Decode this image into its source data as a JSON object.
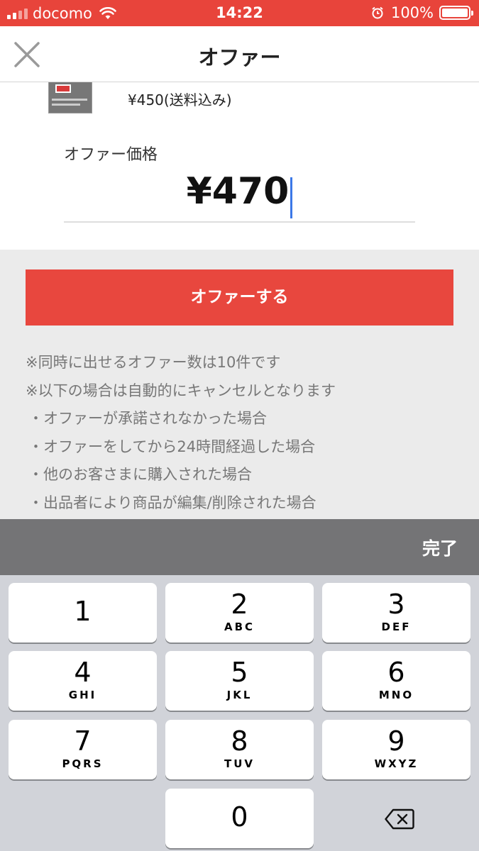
{
  "status_bar": {
    "carrier": "docomo",
    "time": "14:22",
    "battery": "100%"
  },
  "nav": {
    "title": "オファー",
    "close_icon": "close-icon"
  },
  "item": {
    "price": "¥450(送料込み)"
  },
  "offer": {
    "label": "オファー価格",
    "value": "¥470",
    "submit_label": "オファーする"
  },
  "notes": [
    "※同時に出せるオファー数は10件です",
    "※以下の場合は自動的にキャンセルとなります",
    "・オファーが承諾されなかった場合",
    "・オファーをしてから24時間経過した場合",
    "・他のお客さまに購入された場合",
    "・出品者により商品が編集/削除された場合"
  ],
  "keyboard": {
    "done_label": "完了",
    "keys": [
      {
        "num": "1",
        "letters": ""
      },
      {
        "num": "2",
        "letters": "ABC"
      },
      {
        "num": "3",
        "letters": "DEF"
      },
      {
        "num": "4",
        "letters": "GHI"
      },
      {
        "num": "5",
        "letters": "JKL"
      },
      {
        "num": "6",
        "letters": "MNO"
      },
      {
        "num": "7",
        "letters": "PQRS"
      },
      {
        "num": "8",
        "letters": "TUV"
      },
      {
        "num": "9",
        "letters": "WXYZ"
      },
      {
        "num": "0",
        "letters": ""
      }
    ],
    "delete_icon": "backspace-icon"
  },
  "colors": {
    "accent": "#e8443b",
    "button": "#e8473e",
    "caret": "#3b78e7"
  }
}
